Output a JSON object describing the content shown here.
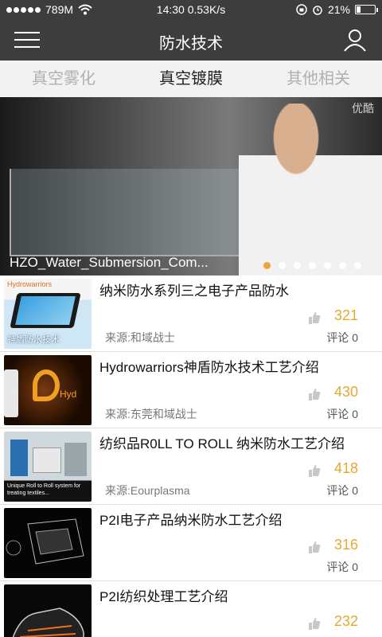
{
  "status_bar": {
    "carrier": "789M",
    "time_speed": "14:30 0.53K/s",
    "battery": "21%",
    "battery_level": 0.21
  },
  "header": {
    "title": "防水技术"
  },
  "tabs": [
    {
      "label": "真空雾化",
      "active": false
    },
    {
      "label": "真空镀膜",
      "active": true
    },
    {
      "label": "其他相关",
      "active": false
    }
  ],
  "banner": {
    "caption": "HZO_Water_Submersion_Com...",
    "watermark": "优酷",
    "page_count": 7,
    "current_page": 1
  },
  "items": [
    {
      "title": "纳米防水系列三之电子产品防水",
      "source": "来源:和域战士",
      "likes": "321",
      "comments": "评论 0"
    },
    {
      "title": "Hydrowarriors神盾防水技术工艺介绍",
      "source": "来源:东莞和域战士",
      "likes": "430",
      "comments": "评论 0"
    },
    {
      "title": "纺织品R0LL TO ROLL 纳米防水工艺介绍",
      "source": "来源:Eourplasma",
      "likes": "418",
      "comments": "评论 0"
    },
    {
      "title": "P2I电子产品纳米防水工艺介绍",
      "source": "",
      "likes": "316",
      "comments": "评论 0"
    },
    {
      "title": "P2I纺织处理工艺介绍",
      "source": "",
      "likes": "232",
      "comments": ""
    }
  ],
  "thumb_text": {
    "item0_brand": "Hydrowarriors",
    "item0_caption": "神盾防水技术",
    "item1_text": "Hyd",
    "item2_caption": "Unique Roll to Roll system for treating textiles..."
  },
  "colors": {
    "bar": "#3d3d3d",
    "accent": "#e8a830",
    "tab_bg": "#f2f2f2",
    "indicator_on": "#f0a040"
  }
}
